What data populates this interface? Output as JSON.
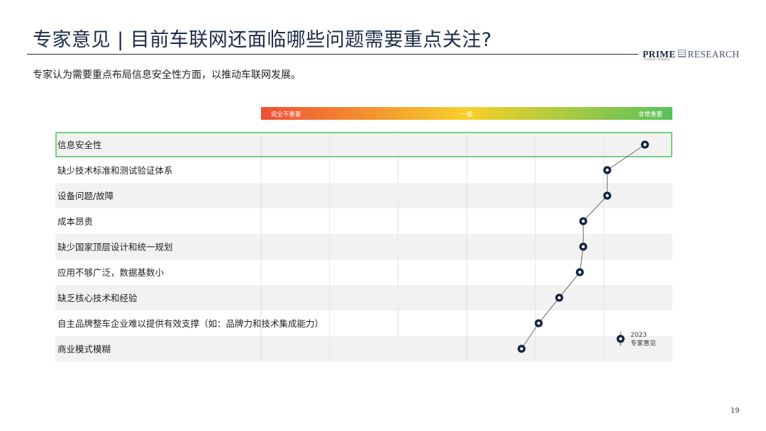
{
  "header": {
    "title": "专家意见 | 目前车联网还面临哪些问题需要重点关注?",
    "subtitle": "专家认为需要重点布局信息安全性方面，以推动车联网发展。"
  },
  "logo": {
    "prime": "PRIME",
    "research": "RESEARCH",
    "tagline": "a Cision company"
  },
  "page_number": "19",
  "colors": {
    "title": "#1c2b4a",
    "marker": "#15233f",
    "row_band": "#f2f2f2",
    "highlight_border": "#5cc46a",
    "scale_low": "#f04e37",
    "scale_mid": "#f7d02a",
    "scale_high": "#58c25a"
  },
  "chart_data": {
    "type": "scatter",
    "scale": {
      "low_label": "完全不重要",
      "mid_label": "一般",
      "high_label": "非常重要",
      "range": [
        0,
        6
      ]
    },
    "categories": [
      "信息安全性",
      "缺少技术标准和测试验证体系",
      "设备问题/故障",
      "成本昂贵",
      "缺少国家顶层设计和统一规划",
      "应用不够广泛，数据基数小",
      "缺乏核心技术和经验",
      "自主品牌整车企业难以提供有效支撑（如：品牌力和技术集成能力）",
      "商业模式模糊"
    ],
    "series": [
      {
        "name": "2023 专家意见",
        "values": [
          5.6,
          5.05,
          5.05,
          4.7,
          4.7,
          4.65,
          4.35,
          4.05,
          3.8
        ]
      }
    ],
    "highlight_category": "信息安全性",
    "legend": {
      "year": "2023",
      "label": "专家意见",
      "position": "bottom-right"
    }
  }
}
